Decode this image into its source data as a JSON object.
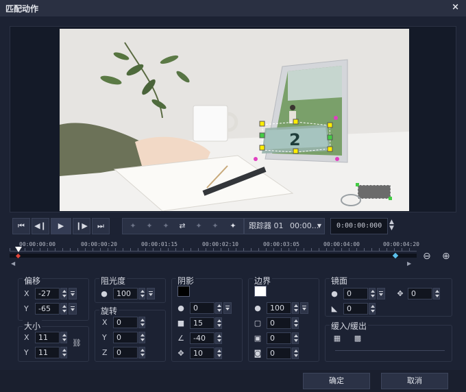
{
  "window": {
    "title": "匹配动作",
    "close_glyph": "×"
  },
  "preview": {
    "overlay_number": "2"
  },
  "playback": {
    "buttons": [
      "⏮",
      "◀❙",
      "▶",
      "❙▶",
      "⏭"
    ],
    "track_buttons": [
      "✦",
      "✦",
      "✦",
      "⇄",
      "✦",
      "✦",
      "✦"
    ],
    "tracker_label": "跟踪器 01",
    "tracker_time": "00:00...",
    "timecode": "0:00:00:000"
  },
  "timeline": {
    "labels": [
      "00:00:00:00",
      "00:00:00:20",
      "00:00:01:15",
      "00:00:02:10",
      "00:00:03:05",
      "00:00:04:00",
      "00:00:04:20"
    ]
  },
  "offset": {
    "label": "偏移",
    "x_label": "X",
    "x": "-27",
    "y_label": "Y",
    "y": "-65"
  },
  "size": {
    "label": "大小",
    "x_label": "X",
    "x": "11",
    "y_label": "Y",
    "y": "11"
  },
  "opacity": {
    "label": "阻光度",
    "value": "100"
  },
  "rotation": {
    "label": "旋转",
    "x_label": "X",
    "x": "0",
    "y_label": "Y",
    "y": "0",
    "z_label": "Z",
    "z": "0"
  },
  "shadow": {
    "label": "阴影",
    "color": "#000000",
    "opacity": "0",
    "blur": "15",
    "angle": "-40",
    "distance": "10"
  },
  "border": {
    "label": "边界",
    "color": "#ffffff",
    "opacity": "100",
    "round": "0",
    "size": "0",
    "inset": "0"
  },
  "mirror": {
    "label": "镜面",
    "opacity": "0",
    "offset": "0",
    "fade": "0"
  },
  "ease": {
    "label": "缓入/缓出"
  },
  "footer": {
    "ok": "确定",
    "cancel": "取消"
  }
}
